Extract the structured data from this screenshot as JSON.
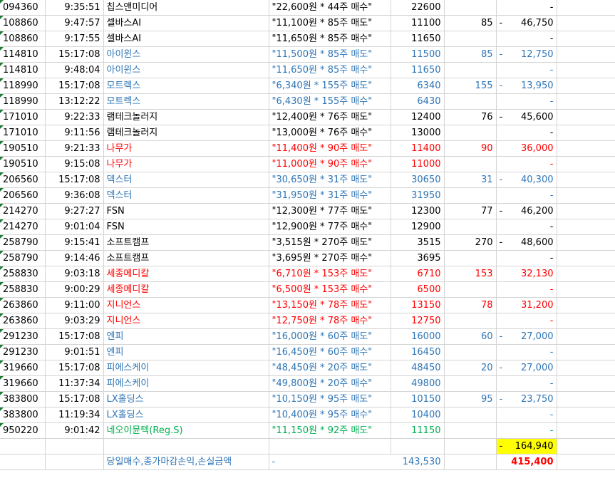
{
  "colors": {
    "black": "#000000",
    "blue": "#2e75b6",
    "red": "#ff0000",
    "green": "#00b050",
    "highlight": "#ffff00"
  },
  "rows": [
    {
      "code": "094360",
      "time": "9:35:51",
      "name": "칩스앤미디어",
      "order": "\"22,600원 * 44주 매수\"",
      "price": "22600",
      "qty": "",
      "dash": "",
      "amount": "-",
      "color": "black"
    },
    {
      "code": "108860",
      "time": "9:47:57",
      "name": "셀바스AI",
      "order": "\"11,100원 * 85주 매도\"",
      "price": "11100",
      "qty": "85",
      "dash": "-",
      "amount": "46,750",
      "color": "black"
    },
    {
      "code": "108860",
      "time": "9:17:55",
      "name": "셀바스AI",
      "order": "\"11,650원 * 85주 매수\"",
      "price": "11650",
      "qty": "",
      "dash": "",
      "amount": "-",
      "color": "black"
    },
    {
      "code": "114810",
      "time": "15:17:08",
      "name": "아이윈스",
      "order": "\"11,500원 * 85주 매도\"",
      "price": "11500",
      "qty": "85",
      "dash": "-",
      "amount": "12,750",
      "color": "blue"
    },
    {
      "code": "114810",
      "time": "9:48:04",
      "name": "아이윈스",
      "order": "\"11,650원 * 85주 매수\"",
      "price": "11650",
      "qty": "",
      "dash": "",
      "amount": "-",
      "color": "blue"
    },
    {
      "code": "118990",
      "time": "15:17:08",
      "name": "모트렉스",
      "order": "\"6,340원 * 155주 매도\"",
      "price": "6340",
      "qty": "155",
      "dash": "-",
      "amount": "13,950",
      "color": "blue"
    },
    {
      "code": "118990",
      "time": "13:12:22",
      "name": "모트렉스",
      "order": "\"6,430원 * 155주 매수\"",
      "price": "6430",
      "qty": "",
      "dash": "",
      "amount": "-",
      "color": "blue"
    },
    {
      "code": "171010",
      "time": "9:22:33",
      "name": "램테크놀러지",
      "order": "\"12,400원 * 76주 매도\"",
      "price": "12400",
      "qty": "76",
      "dash": "-",
      "amount": "45,600",
      "color": "black"
    },
    {
      "code": "171010",
      "time": "9:11:56",
      "name": "램테크놀러지",
      "order": "\"13,000원 * 76주 매수\"",
      "price": "13000",
      "qty": "",
      "dash": "",
      "amount": "-",
      "color": "black"
    },
    {
      "code": "190510",
      "time": "9:21:33",
      "name": "나무가",
      "order": "\"11,400원 * 90주 매도\"",
      "price": "11400",
      "qty": "90",
      "dash": "",
      "amount": "36,000",
      "color": "red"
    },
    {
      "code": "190510",
      "time": "9:15:08",
      "name": "나무가",
      "order": "\"11,000원 * 90주 매수\"",
      "price": "11000",
      "qty": "",
      "dash": "",
      "amount": "-",
      "color": "red"
    },
    {
      "code": "206560",
      "time": "15:17:08",
      "name": "덱스터",
      "order": "\"30,650원 * 31주 매도\"",
      "price": "30650",
      "qty": "31",
      "dash": "-",
      "amount": "40,300",
      "color": "blue"
    },
    {
      "code": "206560",
      "time": "9:36:08",
      "name": "덱스터",
      "order": "\"31,950원 * 31주 매수\"",
      "price": "31950",
      "qty": "",
      "dash": "",
      "amount": "-",
      "color": "blue"
    },
    {
      "code": "214270",
      "time": "9:27:27",
      "name": "FSN",
      "order": "\"12,300원 * 77주 매도\"",
      "price": "12300",
      "qty": "77",
      "dash": "-",
      "amount": "46,200",
      "color": "black"
    },
    {
      "code": "214270",
      "time": "9:01:04",
      "name": "FSN",
      "order": "\"12,900원 * 77주 매수\"",
      "price": "12900",
      "qty": "",
      "dash": "",
      "amount": "-",
      "color": "black"
    },
    {
      "code": "258790",
      "time": "9:15:41",
      "name": "소프트캠프",
      "order": "\"3,515원 * 270주 매도\"",
      "price": "3515",
      "qty": "270",
      "dash": "-",
      "amount": "48,600",
      "color": "black"
    },
    {
      "code": "258790",
      "time": "9:14:46",
      "name": "소프트캠프",
      "order": "\"3,695원 * 270주 매수\"",
      "price": "3695",
      "qty": "",
      "dash": "",
      "amount": "-",
      "color": "black"
    },
    {
      "code": "258830",
      "time": "9:03:18",
      "name": "세종메디칼",
      "order": "\"6,710원 * 153주 매도\"",
      "price": "6710",
      "qty": "153",
      "dash": "",
      "amount": "32,130",
      "color": "red"
    },
    {
      "code": "258830",
      "time": "9:00:29",
      "name": "세종메디칼",
      "order": "\"6,500원 * 153주 매수\"",
      "price": "6500",
      "qty": "",
      "dash": "",
      "amount": "-",
      "color": "red"
    },
    {
      "code": "263860",
      "time": "9:11:00",
      "name": "지니언스",
      "order": "\"13,150원 * 78주 매도\"",
      "price": "13150",
      "qty": "78",
      "dash": "",
      "amount": "31,200",
      "color": "red"
    },
    {
      "code": "263860",
      "time": "9:03:29",
      "name": "지니언스",
      "order": "\"12,750원 * 78주 매수\"",
      "price": "12750",
      "qty": "",
      "dash": "",
      "amount": "-",
      "color": "red"
    },
    {
      "code": "291230",
      "time": "15:17:08",
      "name": "엔피",
      "order": "\"16,000원 * 60주 매도\"",
      "price": "16000",
      "qty": "60",
      "dash": "-",
      "amount": "27,000",
      "color": "blue"
    },
    {
      "code": "291230",
      "time": "9:01:51",
      "name": "엔피",
      "order": "\"16,450원 * 60주 매수\"",
      "price": "16450",
      "qty": "",
      "dash": "",
      "amount": "-",
      "color": "blue"
    },
    {
      "code": "319660",
      "time": "15:17:08",
      "name": "피에스케이",
      "order": "\"48,450원 * 20주 매도\"",
      "price": "48450",
      "qty": "20",
      "dash": "-",
      "amount": "27,000",
      "color": "blue"
    },
    {
      "code": "319660",
      "time": "11:37:34",
      "name": "피에스케이",
      "order": "\"49,800원 * 20주 매수\"",
      "price": "49800",
      "qty": "",
      "dash": "",
      "amount": "-",
      "color": "blue"
    },
    {
      "code": "383800",
      "time": "15:17:08",
      "name": "LX홀딩스",
      "order": "\"10,150원 * 95주 매도\"",
      "price": "10150",
      "qty": "95",
      "dash": "-",
      "amount": "23,750",
      "color": "blue"
    },
    {
      "code": "383800",
      "time": "11:19:34",
      "name": "LX홀딩스",
      "order": "\"10,400원 * 95주 매수\"",
      "price": "10400",
      "qty": "",
      "dash": "",
      "amount": "-",
      "color": "blue"
    },
    {
      "code": "950220",
      "time": "9:01:42",
      "name": "네오이뮨텍(Reg.S)",
      "order": "\"11,150원 * 92주 매도\"",
      "price": "11150",
      "qty": "",
      "dash": "",
      "amount": "-",
      "color": "green"
    }
  ],
  "subtotal": {
    "dash": "-",
    "amount": "164,940"
  },
  "footer": {
    "label": "당일매수,종가마감손익,손실금액",
    "dash": "-",
    "amount": "143,530",
    "total": "415,400"
  }
}
